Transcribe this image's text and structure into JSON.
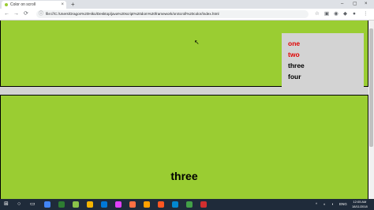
{
  "browser": {
    "tab_title": "Color on scroll",
    "tab_close": "×",
    "new_tab": "+",
    "window_controls": [
      "–",
      "▢",
      "×"
    ],
    "url": "file:///C:/Users/Dragon%20Hiko/Desktop/java%20script%20dom%20framework/onScroll%20color/index.html",
    "url_icon": "ⓘ"
  },
  "page": {
    "nav_items": [
      {
        "label": "one",
        "color": "#e00000"
      },
      {
        "label": "two",
        "color": "#e00000"
      },
      {
        "label": "three",
        "color": "#000000"
      },
      {
        "label": "four",
        "color": "#000000"
      }
    ],
    "section_heading": "three",
    "background_color": "#9acd32"
  },
  "taskbar": {
    "search_glyph": "○",
    "tray_language": "ENG",
    "clock_time": "12:05 AM",
    "clock_date": "18/11/2018"
  }
}
